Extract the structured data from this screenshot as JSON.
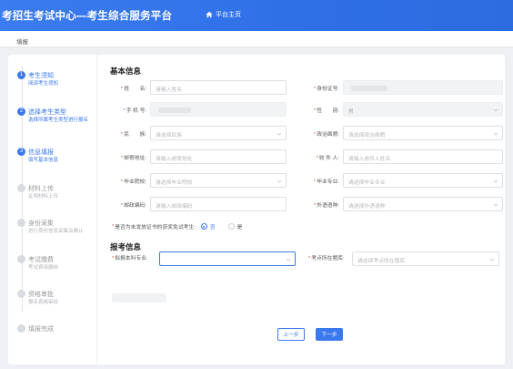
{
  "header": {
    "title": "考招生考试中心—考生综合服务平台",
    "home_label": "平台主页"
  },
  "breadcrumb": "填报",
  "steps": [
    {
      "num": "1",
      "title": "考生须知",
      "desc": "阅读考生须知"
    },
    {
      "num": "2",
      "title": "选择考生类型",
      "desc": "选择所属考生类型进行报名"
    },
    {
      "num": "3",
      "title": "信息填报",
      "desc": "填写基本信息"
    },
    {
      "num": "",
      "title": "材料上传",
      "desc": "证明材料上传"
    },
    {
      "num": "",
      "title": "身份采集",
      "desc": "进行身份信息采集及确认"
    },
    {
      "num": "",
      "title": "考试缴费",
      "desc": "考试费用缴纳"
    },
    {
      "num": "",
      "title": "资格审批",
      "desc": "报名资格审批"
    },
    {
      "num": "",
      "title": "填报完成",
      "desc": ""
    }
  ],
  "basic": {
    "title": "基本信息",
    "name": {
      "label": "姓　　名:",
      "placeholder": "请输入姓名"
    },
    "id_no": {
      "label": "身份证号:"
    },
    "phone": {
      "label": "手 机 号:"
    },
    "gender": {
      "label": "性　　别:",
      "value": "男"
    },
    "ethnicity": {
      "label": "民　　族:",
      "placeholder": "请选择民族"
    },
    "political": {
      "label": "政治面貌:",
      "placeholder": "请选择政治面貌"
    },
    "address": {
      "label": "邮寄地址:",
      "placeholder": "请输入邮寄地址"
    },
    "recipient": {
      "label": "收 件 人:",
      "placeholder": "请输入收件人姓名"
    },
    "grad_school": {
      "label": "毕业院校:",
      "placeholder": "请选择毕业院校"
    },
    "grad_major": {
      "label": "毕业专业:",
      "placeholder": "请选择毕业专业"
    },
    "postcode": {
      "label": "邮政编码:",
      "placeholder": "请输入邮政编码"
    },
    "foreign_lang": {
      "label": "外语语种:",
      "placeholder": "请选择外语语种"
    },
    "radio": {
      "label": "是否为未发放证书的获奖免试考生:",
      "yes": "否",
      "no": "是"
    }
  },
  "exam": {
    "title": "报考信息",
    "major": {
      "label": "拟报本科专业:"
    },
    "site": {
      "label": "考点所在题库:",
      "placeholder": "请选择考点所在题库"
    }
  },
  "buttons": {
    "prev": "上一步",
    "next": "下一步"
  }
}
